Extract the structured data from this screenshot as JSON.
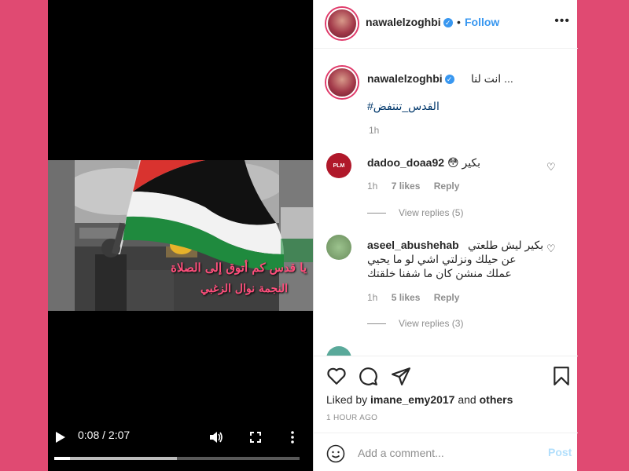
{
  "video": {
    "overlay_line1": "يا قدس كم أتوق إلى الصلاة",
    "overlay_line2": "النجمة نوال الزغبي",
    "time": "0:08 / 2:07",
    "progress": 0.065,
    "buffered": 0.5
  },
  "header": {
    "username": "nawalelzoghbi",
    "dot": "•",
    "follow": "Follow",
    "more": "•••"
  },
  "caption": {
    "username": "nawalelzoghbi",
    "text": "... انت لنا",
    "hashtag": "#القدس_تنتفض",
    "time": "1h"
  },
  "comments": [
    {
      "username": "dadoo_doaa92",
      "text": "بكير 😳",
      "avatar_text": "PLM",
      "time": "1h",
      "likes": "7 likes",
      "reply": "Reply",
      "view_replies": "View replies (5)"
    },
    {
      "username": "aseel_abushehab",
      "text_line1": "بكير ليش طلعتي",
      "text_line2": "عن حيلك ونزلتي اشي لو ما يحيي",
      "text_line3": "عملك منشن كان ما شفنا خلقتك",
      "time": "1h",
      "likes": "5 likes",
      "reply": "Reply",
      "view_replies": "View replies (3)"
    }
  ],
  "actions": {
    "liked_prefix": "Liked by ",
    "liked_user": "imane_emy2017",
    "liked_mid": " and ",
    "liked_others": "others",
    "post_time": "1 HOUR AGO"
  },
  "comment_box": {
    "placeholder": "Add a comment...",
    "post": "Post"
  },
  "colors": {
    "background": "#e04a72",
    "link": "#3897f0",
    "post_disabled": "#b2dffc"
  }
}
